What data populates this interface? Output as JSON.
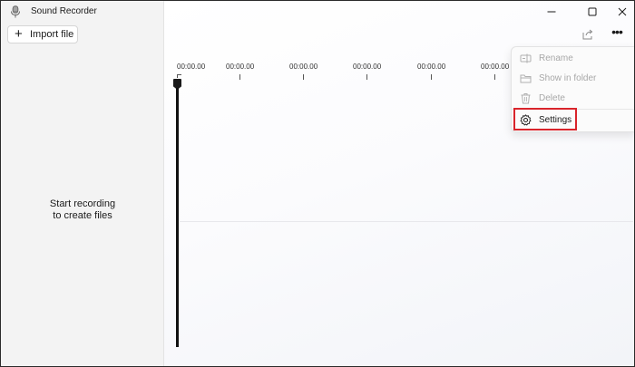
{
  "app": {
    "title": "Sound Recorder"
  },
  "sidebar": {
    "import_label": "Import file",
    "empty_message_line1": "Start recording",
    "empty_message_line2": "to create files"
  },
  "window_controls": {
    "minimize": "minimize",
    "maximize": "maximize",
    "close": "close"
  },
  "timeline": {
    "labels": [
      "00:00.00",
      "00:00.00",
      "00:00.00",
      "00:00.00",
      "00:00.00",
      "00:00.00"
    ]
  },
  "context_menu": {
    "items": [
      {
        "label": "Rename",
        "icon": "rename-icon",
        "enabled": false
      },
      {
        "label": "Show in folder",
        "icon": "folder-icon",
        "enabled": false
      },
      {
        "label": "Delete",
        "icon": "trash-icon",
        "enabled": false
      },
      {
        "label": "Settings",
        "icon": "gear-icon",
        "enabled": true
      }
    ]
  },
  "colors": {
    "highlight": "#d9242b",
    "sidebar_bg": "#f3f3f3"
  }
}
